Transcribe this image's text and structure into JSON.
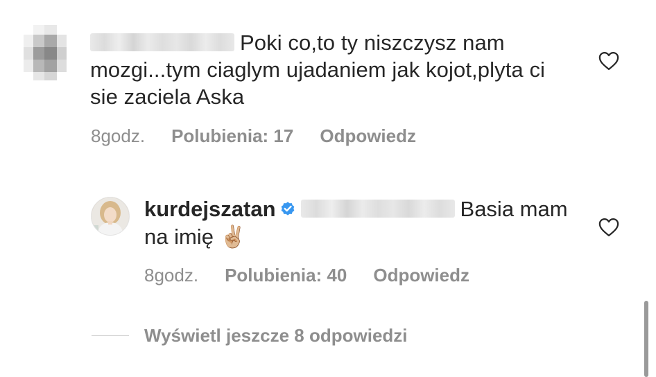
{
  "comments": [
    {
      "username": "",
      "text": "Poki co,to ty niszczysz nam mozgi...tym ciaglym ujadaniem jak kojot,plyta ci sie zaciela Aska",
      "time": "8godz.",
      "likes": "Polubienia: 17",
      "reply_label": "Odpowiedz",
      "like_icon": "heart-outline-icon",
      "avatar": "blurred-avatar"
    },
    {
      "username": "kurdejszatan",
      "verified_icon": "verified-badge-icon",
      "text": "Basia mam na imię ✌🏼",
      "time": "8godz.",
      "likes": "Polubienia: 40",
      "reply_label": "Odpowiedz",
      "like_icon": "heart-outline-icon",
      "avatar": "profile-photo"
    }
  ],
  "more_replies": {
    "label": "Wyświetl jeszcze 8 odpowiedzi"
  },
  "colors": {
    "text": "#262626",
    "secondary": "#8e8e8e",
    "verified": "#3897f0",
    "background": "#ffffff"
  }
}
